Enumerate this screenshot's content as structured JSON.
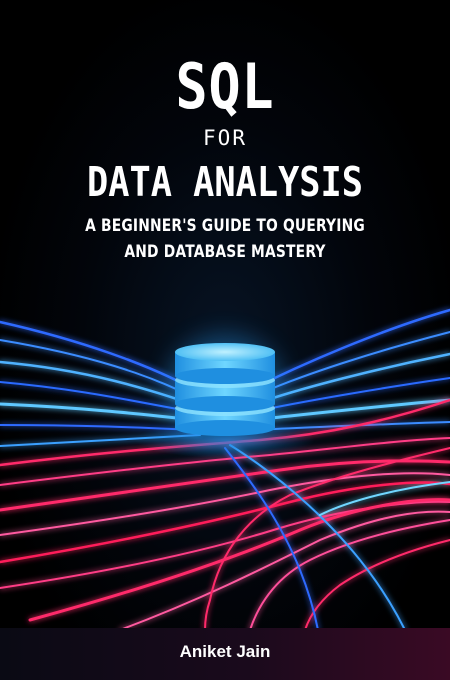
{
  "book": {
    "title_line1": "SQL",
    "title_line2": "FOR",
    "title_line3": "DATA ANALYSIS",
    "subtitle_line1": "A BEGINNER'S GUIDE TO QUERYING",
    "subtitle_line2": "AND DATABASE MASTERY",
    "author": "Aniket Jain"
  },
  "artwork": {
    "icon": "database-cylinder-icon",
    "colors": {
      "background": "#000000",
      "cyan_glow": "#38c8ff",
      "blue_light": "#2e6bff",
      "magenta_light": "#ff2a6a",
      "pink_light": "#ff4f9a"
    }
  }
}
